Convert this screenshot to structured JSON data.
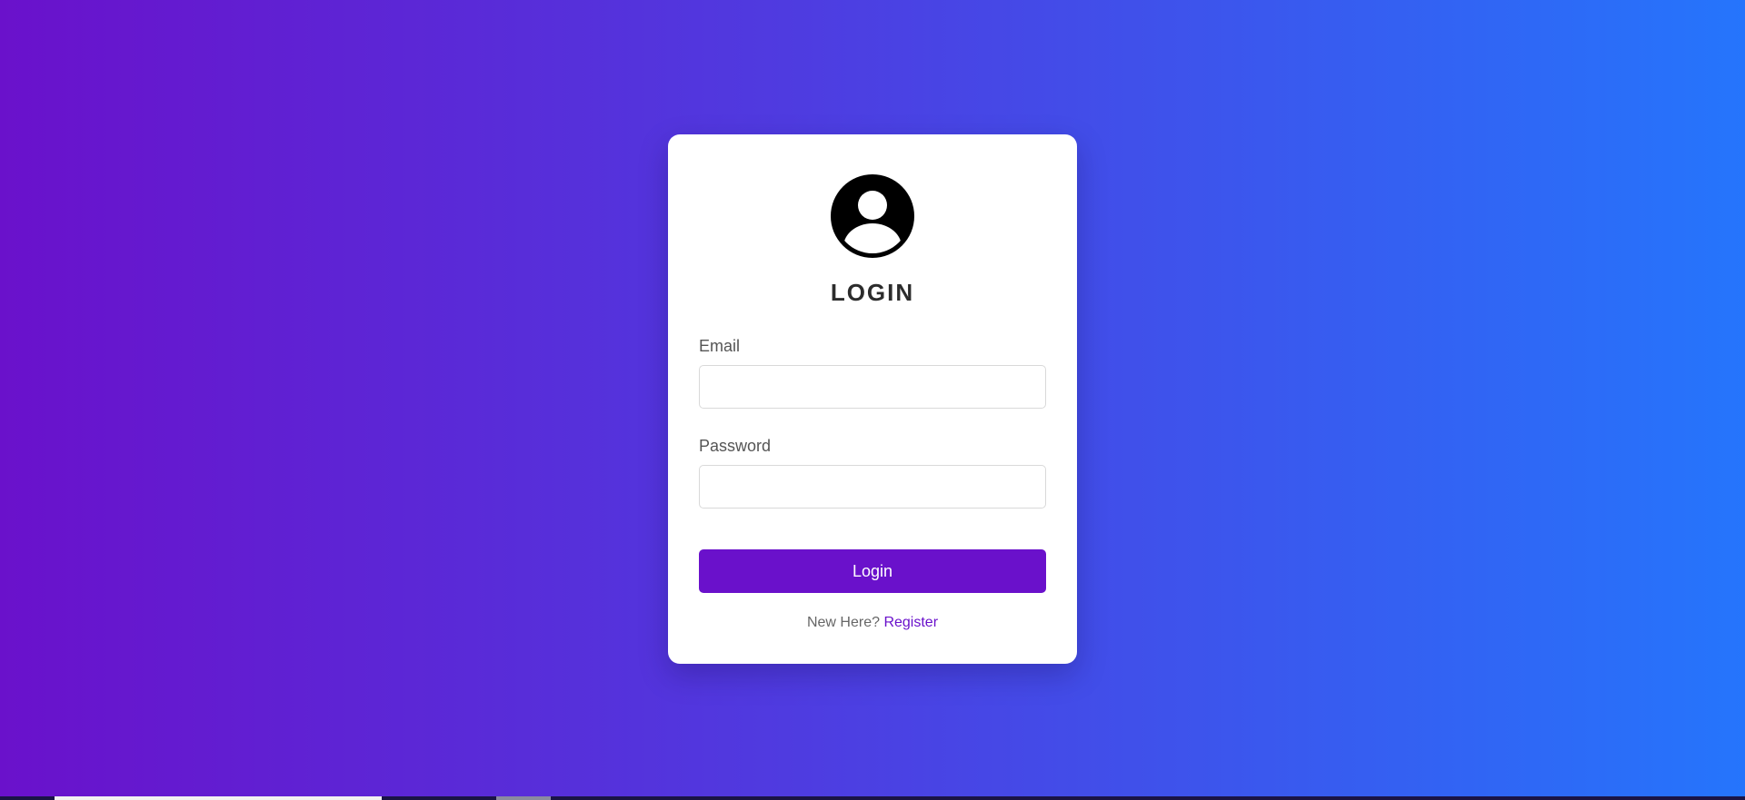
{
  "login_card": {
    "avatar_icon": "user-circle-icon",
    "title": "LOGIN",
    "email": {
      "label": "Email",
      "value": "",
      "placeholder": ""
    },
    "password": {
      "label": "Password",
      "value": "",
      "placeholder": ""
    },
    "login_button_label": "Login",
    "register_prompt": "New Here?",
    "register_link": "Register"
  },
  "colors": {
    "gradient_start": "#6a11cb",
    "gradient_end": "#2575fc",
    "accent": "#6a11cb",
    "card_background": "#ffffff"
  }
}
